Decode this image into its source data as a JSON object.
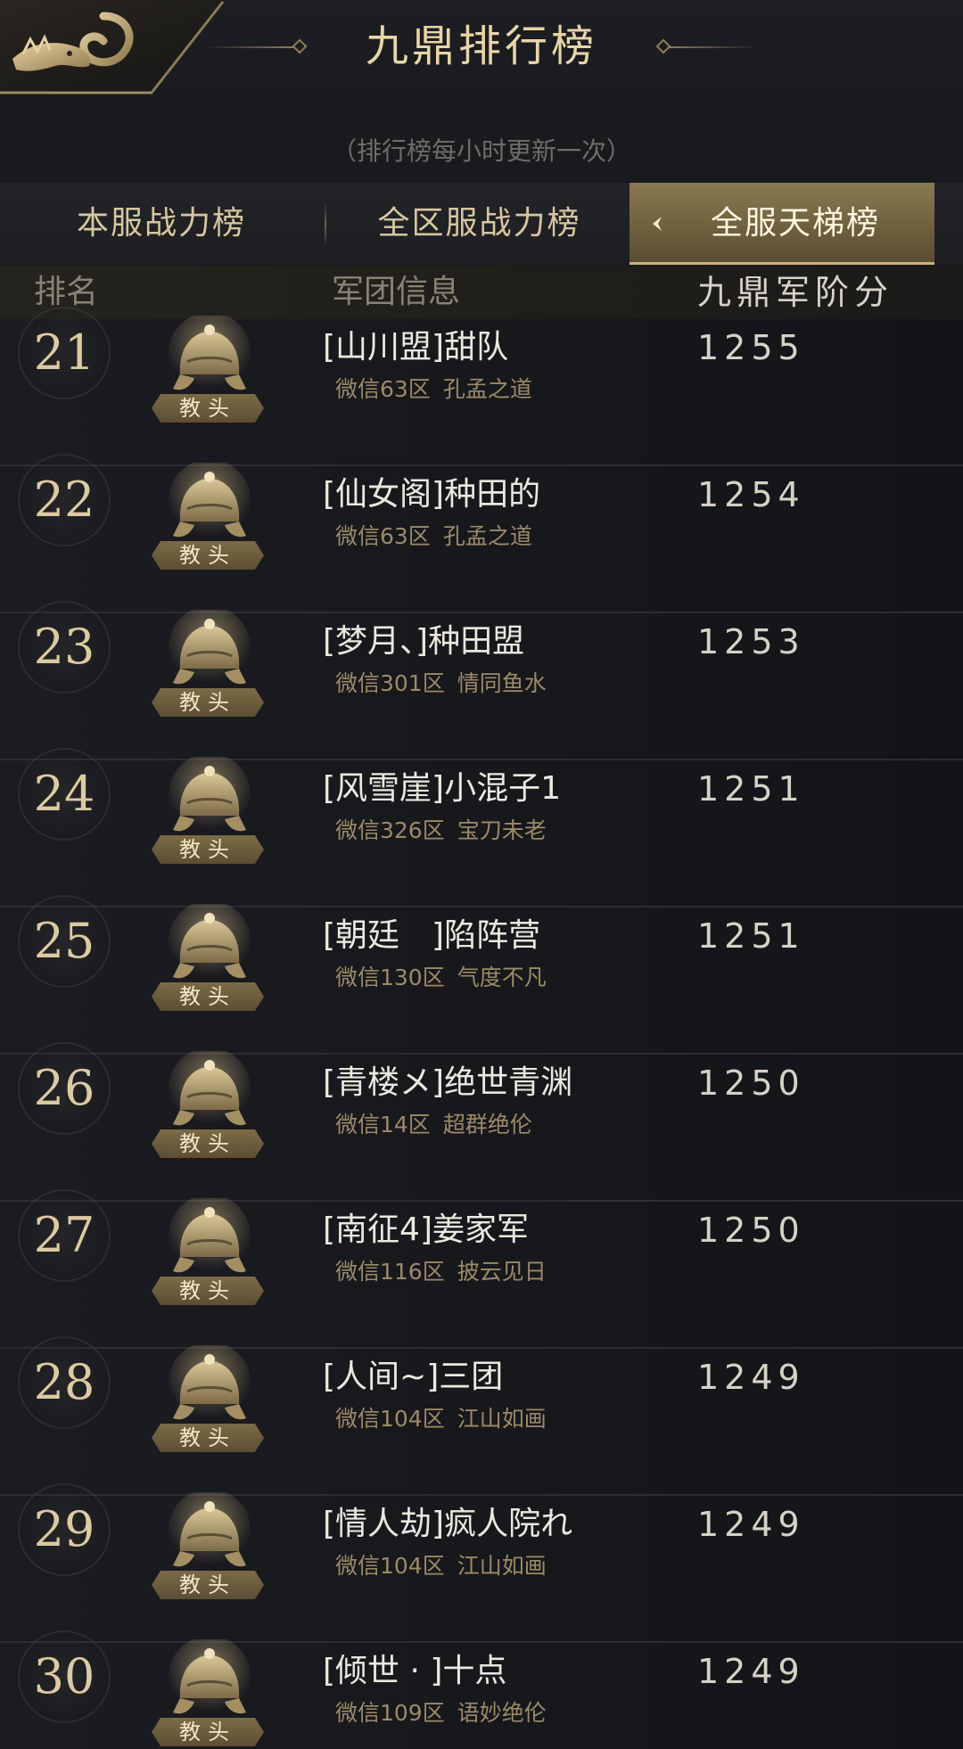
{
  "header": {
    "title": "九鼎排行榜",
    "subtitle": "（排行榜每小时更新一次）"
  },
  "tabs": [
    {
      "label": "本服战力榜",
      "active": false
    },
    {
      "label": "全区服战力榜",
      "active": false
    },
    {
      "label": "全服天梯榜",
      "active": true
    }
  ],
  "columns": {
    "rank": "排名",
    "info": "军团信息",
    "score": "九鼎军阶分"
  },
  "badge_label": "教头",
  "rows": [
    {
      "rank": "21",
      "name": "[山川盟]甜队",
      "server": "微信63区",
      "title": "孔孟之道",
      "score": "1255"
    },
    {
      "rank": "22",
      "name": "[仙女阁]种田的",
      "server": "微信63区",
      "title": "孔孟之道",
      "score": "1254"
    },
    {
      "rank": "23",
      "name": "[梦月、]种田盟",
      "server": "微信301区",
      "title": "情同鱼水",
      "score": "1253"
    },
    {
      "rank": "24",
      "name": "[风雪崖]小混子1",
      "server": "微信326区",
      "title": "宝刀未老",
      "score": "1251"
    },
    {
      "rank": "25",
      "name": "[朝廷　]陷阵营",
      "server": "微信130区",
      "title": "气度不凡",
      "score": "1251"
    },
    {
      "rank": "26",
      "name": "[青楼メ]绝世青渊",
      "server": "微信14区",
      "title": "超群绝伦",
      "score": "1250"
    },
    {
      "rank": "27",
      "name": "[南征4]姜家军",
      "server": "微信116区",
      "title": "披云见日",
      "score": "1250"
    },
    {
      "rank": "28",
      "name": "[人间~]三团",
      "server": "微信104区",
      "title": "江山如画",
      "score": "1249"
    },
    {
      "rank": "29",
      "name": "[情人劫]疯人院れ",
      "server": "微信104区",
      "title": "江山如画",
      "score": "1249"
    },
    {
      "rank": "30",
      "name": "[倾世 · ]十点",
      "server": "微信109区",
      "title": "语妙绝伦",
      "score": "1249"
    }
  ],
  "colors": {
    "accent_gold": "#d7c79e",
    "active_tab": "#7a6b46",
    "server_text": "#9c8a66"
  }
}
